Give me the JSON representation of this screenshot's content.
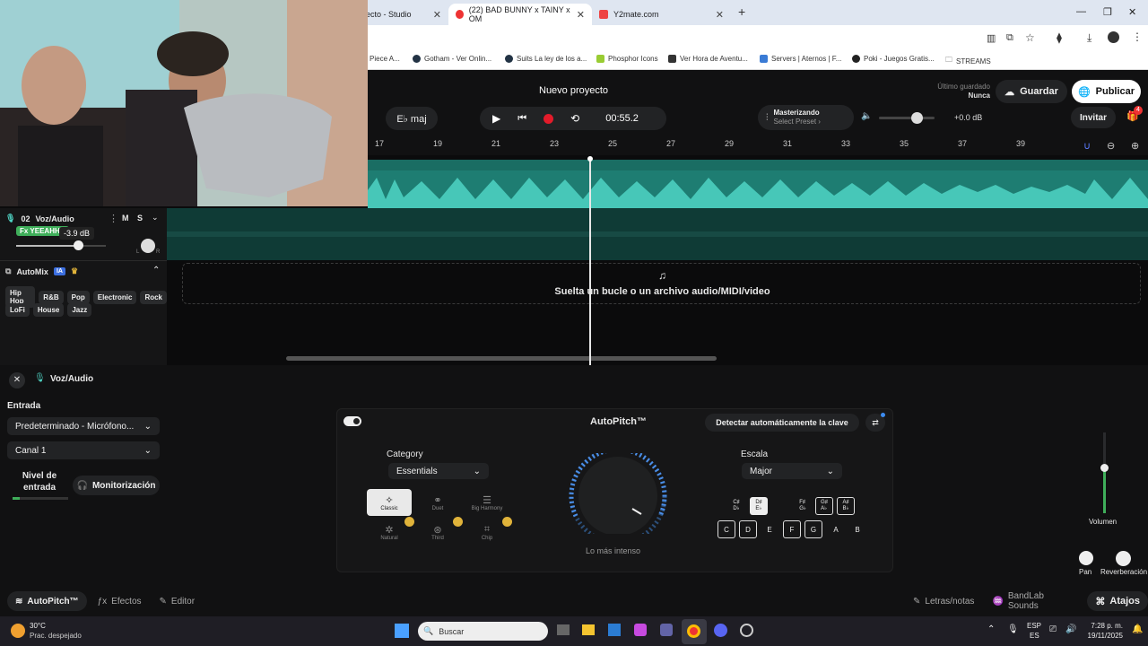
{
  "browser": {
    "tabs": [
      {
        "label": "ecto - Studio"
      },
      {
        "label": "(22) BAD BUNNY x TAINY x OM"
      },
      {
        "label": "Y2mate.com"
      }
    ],
    "bookmarks": [
      "Piece A...",
      "Gotham - Ver Onlin...",
      "Suits La ley de los a...",
      "Phosphor Icons",
      "Ver Hora de Aventu...",
      "Servers | Aternos | F...",
      "Poki - Juegos Gratis...",
      "STREAMS"
    ]
  },
  "header": {
    "project_title": "Nuevo proyecto",
    "key_label": "E♭ maj",
    "time": "00:55.2",
    "mastering_label": "Masterizando",
    "preset_label": "Select Preset ›",
    "volume_db": "+0.0 dB",
    "last_saved_label": "Último guardado",
    "last_saved_value": "Nunca",
    "save_label": "Guardar",
    "publish_label": "Publicar",
    "invite_label": "Invitar",
    "notif_count": "4"
  },
  "ruler": {
    "bars": [
      "17",
      "19",
      "21",
      "23",
      "25",
      "27",
      "29",
      "31",
      "33",
      "35",
      "37",
      "39"
    ]
  },
  "track": {
    "number": "02",
    "name": "Voz/Audio",
    "mute": "M",
    "solo": "S",
    "fx_label": "Fx YEEAHHH",
    "gain": "-3.9 dB",
    "pan_l": "L",
    "pan_r": "R"
  },
  "automix": {
    "label": "AutoMix",
    "badge": "IA",
    "genres": [
      "Hip Hop",
      "R&B",
      "Pop",
      "Electronic",
      "Rock",
      "LoFi",
      "House",
      "Jazz"
    ]
  },
  "dropzone": {
    "text": "Suelta un bucle o un archivo audio/MIDI/video"
  },
  "panel": {
    "title": "Voz/Audio",
    "input_label": "Entrada",
    "input_device": "Predeterminado - Micrófono...",
    "channel": "Canal 1",
    "level_label": "Nivel de entrada",
    "monitor_label": "Monitorización",
    "autopitch_title": "AutoPitch™",
    "detect_key": "Detectar automáticamente la clave",
    "category_label": "Category",
    "category_value": "Essentials",
    "modes": [
      {
        "label": "Classic"
      },
      {
        "label": "Duet"
      },
      {
        "label": "Big Harmony"
      },
      {
        "label": "Natural"
      },
      {
        "label": "Third"
      },
      {
        "label": "Chip"
      }
    ],
    "knob_label": "Lo más intenso",
    "scale_label": "Escala",
    "scale_value": "Major",
    "black_keys": [
      "C♯\nD♭",
      "D♯\nE♭",
      "F♯\nG♭",
      "G♯\nA♭",
      "A♯\nB♭"
    ],
    "white_keys": [
      "C",
      "D",
      "E",
      "F",
      "G",
      "A",
      "B"
    ],
    "volume_label": "Volumen",
    "pan_label": "Pan",
    "reverb_label": "Reverberación"
  },
  "bottom_bar": {
    "autopitch": "AutoPitch™",
    "effects": "Efectos",
    "editor": "Editor",
    "lyrics": "Letras/notas",
    "sounds": "BandLab Sounds",
    "shortcuts": "Atajos"
  },
  "taskbar": {
    "temp": "30°C",
    "weather": "Prac. despejado",
    "search": "Buscar",
    "lang1": "ESP",
    "lang2": "ES",
    "time": "7:28 p. m.",
    "date": "19/11/2025"
  }
}
